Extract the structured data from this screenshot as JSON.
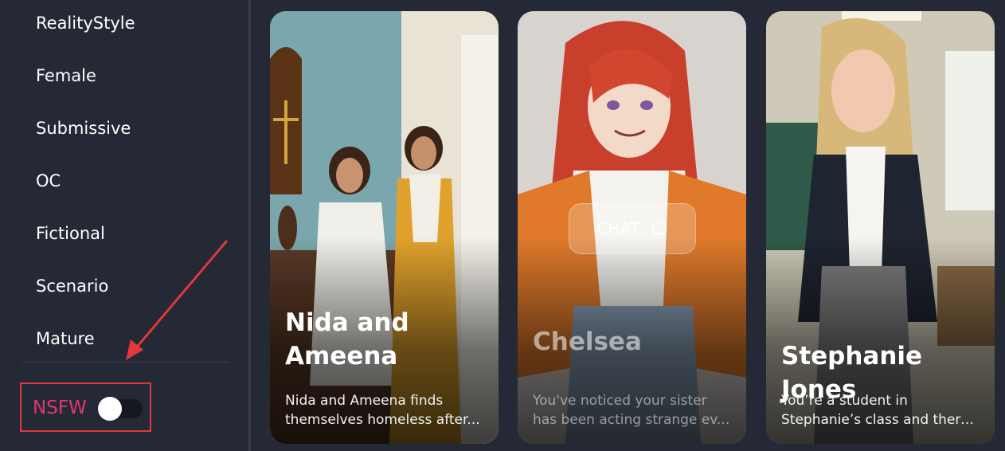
{
  "sidebar": {
    "categories": [
      "RealityStyle",
      "Female",
      "Submissive",
      "OC",
      "Fictional",
      "Scenario",
      "Mature"
    ],
    "nsfw_label": "NSFW",
    "nsfw_enabled": false
  },
  "cards": [
    {
      "name_line1": "Nida and",
      "name_line2": "Ameena",
      "desc_line1": "Nida and Ameena finds",
      "desc_line2": "themselves homeless after..."
    },
    {
      "name_line1": "Chelsea",
      "desc_line1": "You've noticed your sister",
      "desc_line2": "has been acting strange ev...",
      "chat_label": "CHAT"
    },
    {
      "name_line1": "Stephanie Jones",
      "desc_line1": "You’re a student in",
      "desc_line2": "Stephanie’s class and there..."
    }
  ],
  "icons": {
    "chat": "speech-bubble-icon",
    "annotation": "red-arrow-icon"
  },
  "colors": {
    "background": "#252935",
    "nsfw_text": "#e0386a",
    "highlight_border": "#e0383b"
  }
}
